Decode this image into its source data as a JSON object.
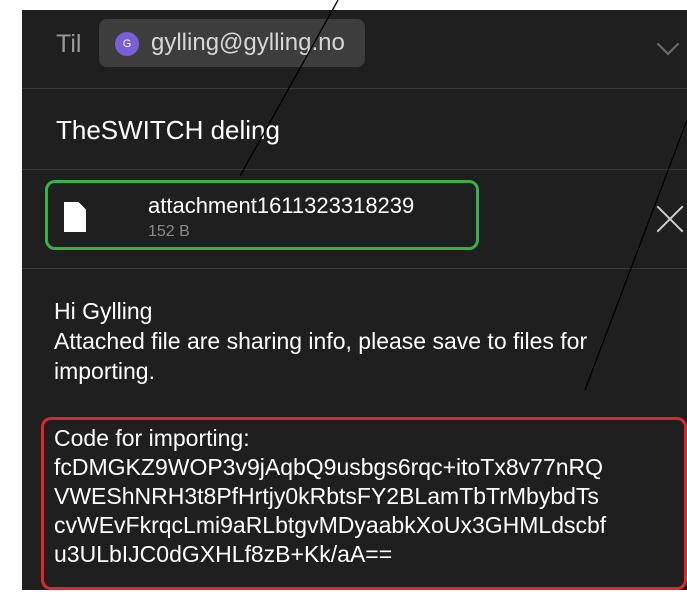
{
  "compose": {
    "to_label": "Til",
    "recipient": {
      "avatar_letter": "G",
      "email": "gylling@gylling.no"
    },
    "subject": "TheSWITCH deling",
    "attachment": {
      "name": "attachment1611323318239",
      "size": "152 B"
    },
    "body_lines": [
      "Hi Gylling",
      "Attached file are sharing info, please save to files for",
      "importing."
    ],
    "code_lines": [
      "Code for importing:",
      "fcDMGKZ9WOP3v9jAqbQ9usbgs6rqc+itoTx8v77nRQ",
      "VWEShNRH3t8PfHrtjy0kRbtsFY2BLamTbTrMbybdTs",
      "cvWEvFkrqcLmi9aRLbtgvMDyaabkXoUx3GHMLdscbf",
      "u3ULbIJC0dGXHLf8zB+Kk/aA=="
    ]
  },
  "colors": {
    "background": "#1f1f1f",
    "attachment_highlight": "#34b34a",
    "code_highlight": "#e0262a",
    "avatar": "#7b5fd6"
  },
  "icons": {
    "file": "file-icon",
    "close": "close-icon",
    "expand": "chevron-down-icon"
  }
}
